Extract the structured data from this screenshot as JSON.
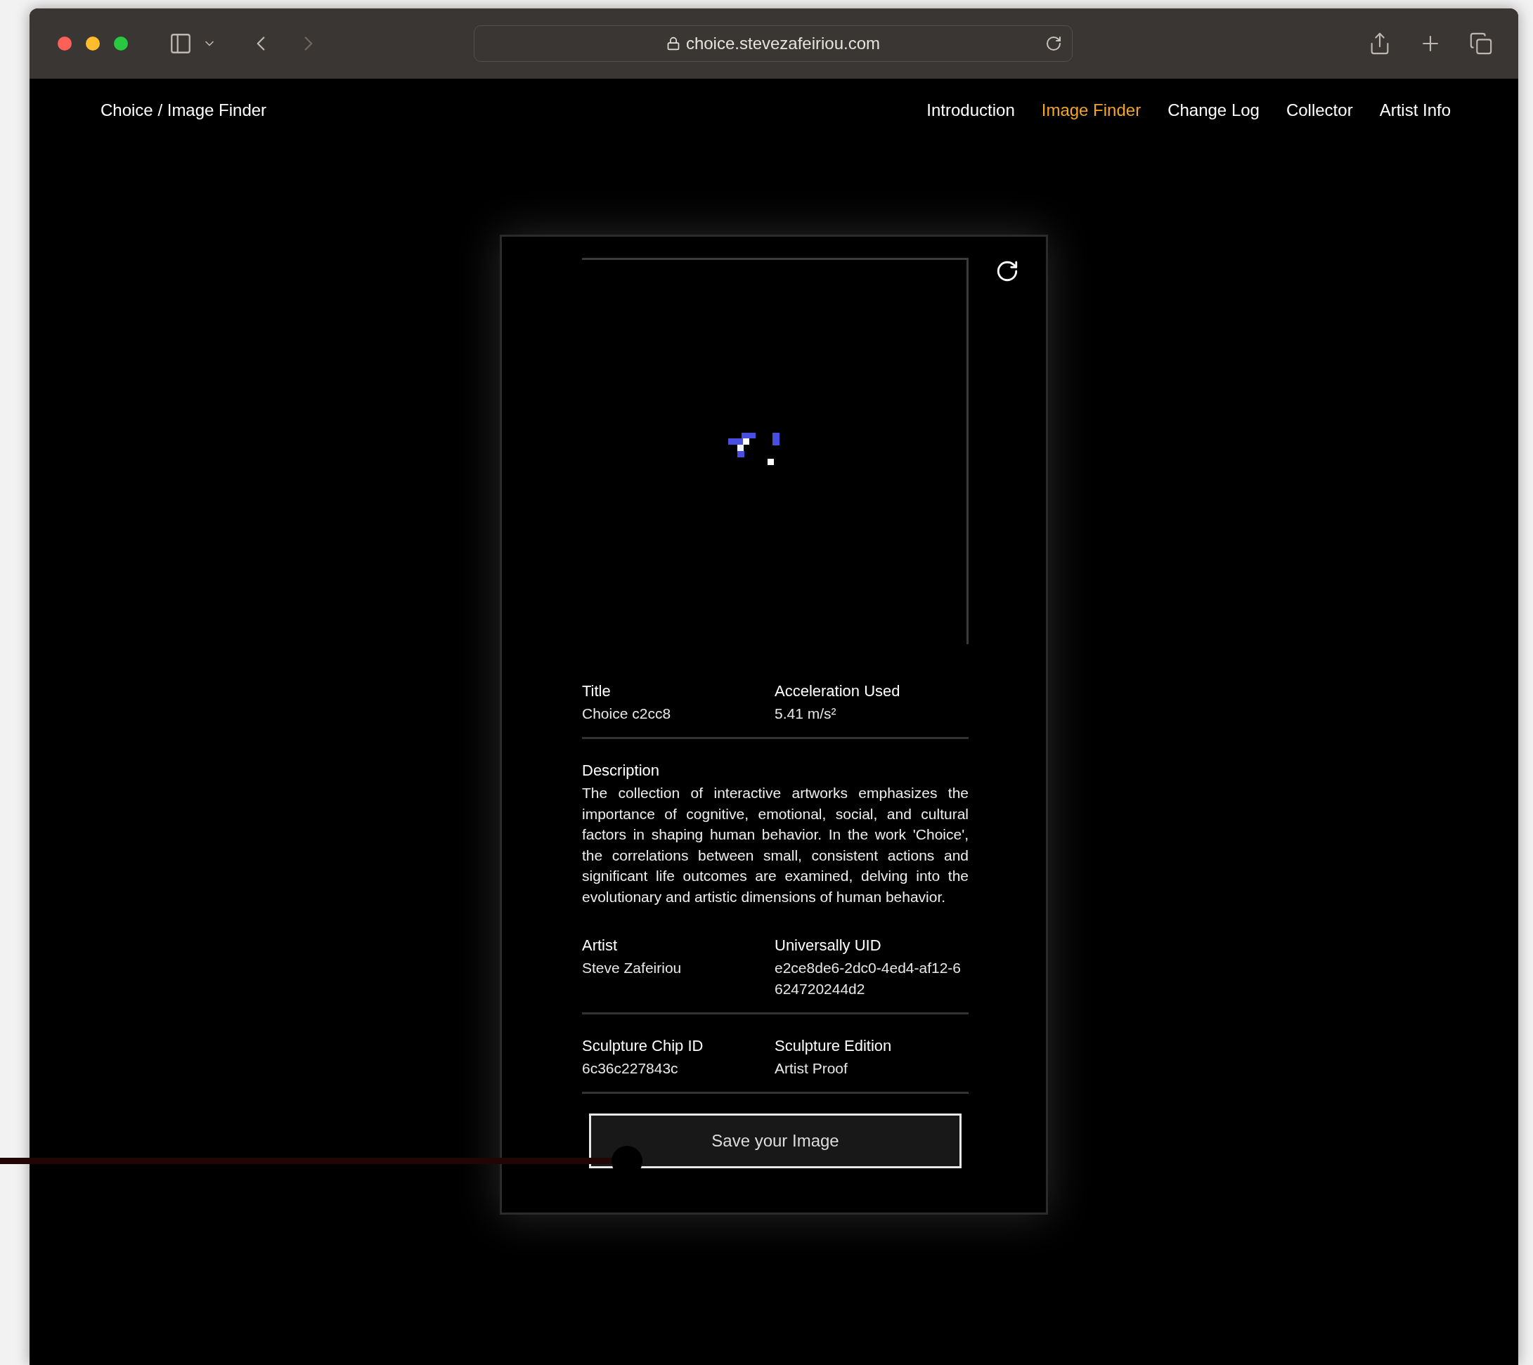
{
  "browser": {
    "url": "choice.stevezafeiriou.com"
  },
  "site": {
    "brand": "Choice / Image Finder",
    "nav": [
      {
        "label": "Introduction",
        "selected": false
      },
      {
        "label": "Image Finder",
        "selected": true
      },
      {
        "label": "Change Log",
        "selected": false
      },
      {
        "label": "Collector",
        "selected": false
      },
      {
        "label": "Artist Info",
        "selected": false
      }
    ]
  },
  "card": {
    "rows": [
      {
        "kind": "pair",
        "fields": [
          {
            "label": "Title",
            "value": "Choice c2cc8"
          },
          {
            "label": "Acceleration Used",
            "value": "5.41 m/s²"
          }
        ]
      },
      {
        "kind": "text",
        "label": "Description",
        "value": "The collection of interactive artworks emphasizes the importance of cognitive, emotional, social, and cultural factors in shaping human behavior. In the work 'Choice', the correlations between small, consistent actions and significant life outcomes are examined, delving into the evolutionary and artistic dimensions of human behavior."
      },
      {
        "kind": "pair",
        "fields": [
          {
            "label": "Artist",
            "value": "Steve Zafeiriou"
          },
          {
            "label": "Universally UID",
            "value": "e2ce8de6-2dc0-4ed4-af12-6624720244d2"
          }
        ]
      },
      {
        "kind": "pair",
        "fields": [
          {
            "label": "Sculpture Chip ID",
            "value": "6c36c227843c"
          },
          {
            "label": "Sculpture Edition",
            "value": "Artist Proof"
          }
        ]
      }
    ],
    "button": "Save your Image"
  }
}
